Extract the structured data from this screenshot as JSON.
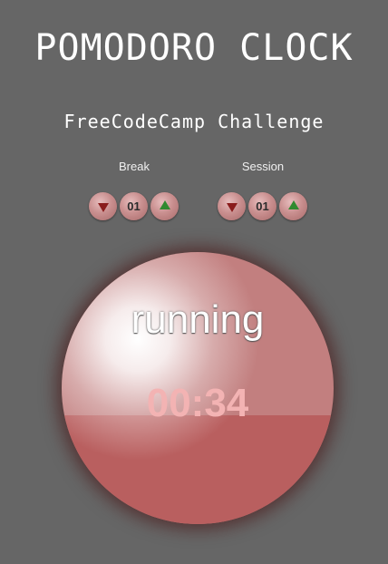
{
  "header": {
    "title": "Pomodoro Clock",
    "subtitle": "FreeCodeCamp Challenge"
  },
  "break": {
    "label": "Break",
    "value": "01",
    "decrement_icon": "arrow-down-icon",
    "increment_icon": "arrow-up-icon"
  },
  "session": {
    "label": "Session",
    "value": "01",
    "decrement_icon": "arrow-down-icon",
    "increment_icon": "arrow-up-icon"
  },
  "clock": {
    "status": "running",
    "time": "00:34",
    "progress": 0.4,
    "colors": {
      "base": "#c27f7f",
      "fill": "#b95f5f",
      "time_text": "#f3b3b3"
    }
  }
}
